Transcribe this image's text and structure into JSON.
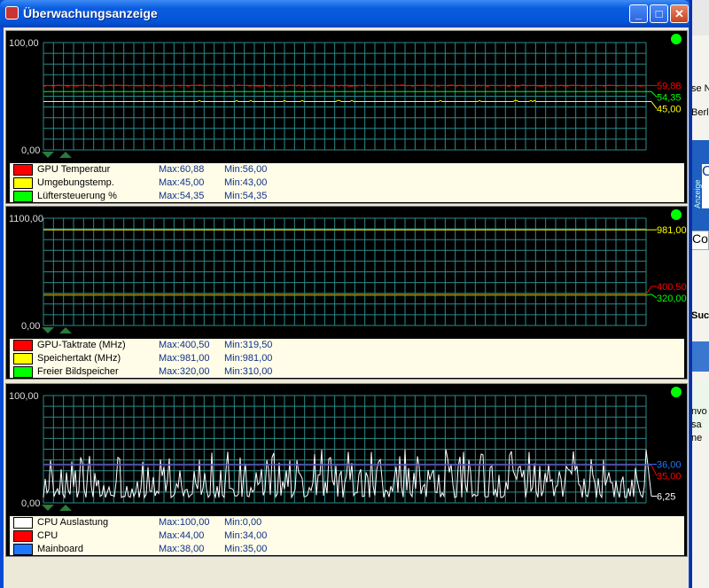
{
  "window": {
    "title": "Überwachungsanzeige",
    "buttons": [
      "minimize",
      "maximize",
      "close"
    ]
  },
  "background_fragments": [
    "se N",
    "Berl",
    "Anzeige",
    "C",
    "Co",
    "Suc",
    "nvo",
    "sa",
    "ne"
  ],
  "panels": [
    {
      "ymax_label": "100,00",
      "ymin_label": "0,00",
      "ylim": [
        0,
        100
      ],
      "series": [
        {
          "name": "GPU Temperatur",
          "color": "#ff0000",
          "max": "Max:60,88",
          "min": "Min:56,00",
          "current": "59,88",
          "value": 59.88
        },
        {
          "name": "Umgebungstemp.",
          "color": "#ffff00",
          "max": "Max:45,00",
          "min": "Min:43,00",
          "current": "45,00",
          "value": 45
        },
        {
          "name": "Lüftersteuerung %",
          "color": "#00ff00",
          "max": "Max:54,35",
          "min": "Min:54,35",
          "current": "54,35",
          "value": 54.35
        }
      ]
    },
    {
      "ymax_label": "1100,00",
      "ymin_label": "0,00",
      "ylim": [
        0,
        1100
      ],
      "series": [
        {
          "name": "GPU-Taktrate (MHz)",
          "color": "#ff0000",
          "max": "Max:400,50",
          "min": "Min:319,50",
          "current": "400,50",
          "value": 400.5,
          "history": 319.5
        },
        {
          "name": "Speichertakt (MHz)",
          "color": "#ffff00",
          "max": "Max:981,00",
          "min": "Min:981,00",
          "current": "981,00",
          "value": 981
        },
        {
          "name": "Freier Bildspeicher",
          "color": "#00ff00",
          "max": "Max:320,00",
          "min": "Min:310,00",
          "current": "320,00",
          "value": 320,
          "history": 310
        }
      ]
    },
    {
      "ymax_label": "100,00",
      "ymin_label": "0,00",
      "ylim": [
        0,
        100
      ],
      "series": [
        {
          "name": "CPU Auslastung",
          "color": "#ffffff",
          "max": "Max:100,00",
          "min": "Min:0,00",
          "current": "6,25",
          "value": 6.25
        },
        {
          "name": "CPU",
          "color": "#ff0000",
          "max": "Max:44,00",
          "min": "Min:34,00",
          "current": "35,00",
          "value": 35
        },
        {
          "name": "Mainboard",
          "color": "#1e78ff",
          "max": "Max:38,00",
          "min": "Min:35,00",
          "current": "36,00",
          "value": 36
        }
      ]
    }
  ],
  "grid_color": "#2a8a8a",
  "status_led_color": "#00ff00"
}
